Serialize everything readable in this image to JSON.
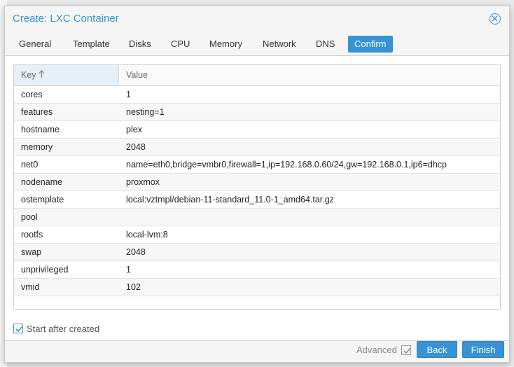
{
  "dialog": {
    "title": "Create: LXC Container"
  },
  "tabs": [
    {
      "label": "General"
    },
    {
      "label": "Template"
    },
    {
      "label": "Disks"
    },
    {
      "label": "CPU"
    },
    {
      "label": "Memory"
    },
    {
      "label": "Network"
    },
    {
      "label": "DNS"
    },
    {
      "label": "Confirm",
      "active": true
    }
  ],
  "grid": {
    "columns": {
      "key": "Key",
      "value": "Value"
    },
    "sort": "ascending-by-key",
    "rows": [
      {
        "key": "cores",
        "value": "1"
      },
      {
        "key": "features",
        "value": "nesting=1"
      },
      {
        "key": "hostname",
        "value": "plex"
      },
      {
        "key": "memory",
        "value": "2048"
      },
      {
        "key": "net0",
        "value": "name=eth0,bridge=vmbr0,firewall=1,ip=192.168.0.60/24,gw=192.168.0.1,ip6=dhcp"
      },
      {
        "key": "nodename",
        "value": "proxmox"
      },
      {
        "key": "ostemplate",
        "value": "local:vztmpl/debian-11-standard_11.0-1_amd64.tar.gz"
      },
      {
        "key": "pool",
        "value": ""
      },
      {
        "key": "rootfs",
        "value": "local-lvm:8"
      },
      {
        "key": "swap",
        "value": "2048"
      },
      {
        "key": "unprivileged",
        "value": "1"
      },
      {
        "key": "vmid",
        "value": "102"
      }
    ]
  },
  "start_after_created": {
    "label": "Start after created",
    "checked": true
  },
  "footer": {
    "advanced_label": "Advanced",
    "advanced_checked": true,
    "back_label": "Back",
    "finish_label": "Finish"
  },
  "colors": {
    "accent": "#3892d4"
  }
}
